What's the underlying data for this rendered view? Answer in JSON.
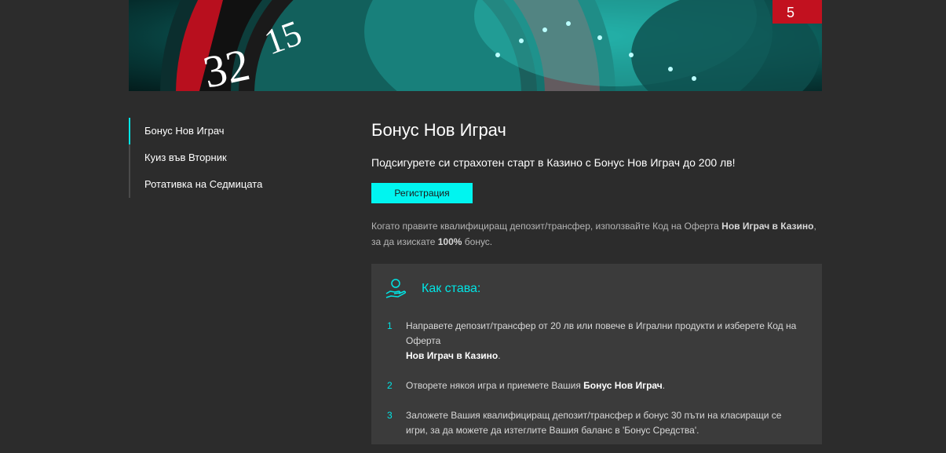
{
  "hero": {
    "wheel_numbers": [
      "32",
      "15",
      "5"
    ]
  },
  "sidebar": {
    "items": [
      {
        "label": "Бонус Нов Играч"
      },
      {
        "label": "Куиз във Вторник"
      },
      {
        "label": "Ротативка на Седмицата"
      }
    ]
  },
  "main": {
    "title": "Бонус Нов Играч",
    "subtitle": "Подсигурете си страхотен старт в Казино с Бонус Нов Играч до 200 лв!",
    "register_label": "Регистрация",
    "desc_part1": "Когато правите квалифициращ депозит/трансфер, използвайте Код на Оферта ",
    "desc_code": "Нов Играч в Казино",
    "desc_part2": ",",
    "desc_part3": "за да изискате ",
    "desc_percent": "100%",
    "desc_part4": " бонус."
  },
  "howto": {
    "title": "Как става:",
    "steps": [
      {
        "num": "1",
        "text": "Направете депозит/трансфер от 20 лв или повече в Игрални продукти и изберете Код на Оферта ",
        "bold": "Нов Играч в Казино",
        "after": "."
      },
      {
        "num": "2",
        "text": "Отворете някоя игра и приемете Вашия ",
        "bold": "Бонус Нов Играч",
        "after": "."
      },
      {
        "num": "3",
        "text": "Заложете Вашия квалифициращ депозит/трансфер и бонус 30 пъти на класиращи се игри, за да можете да изтеглите Вашия баланс в 'Бонус Средства'.",
        "bold": "",
        "after": ""
      }
    ]
  },
  "colors": {
    "accent": "#00e5e5",
    "button": "#00f5f0",
    "background": "#2c2c2c",
    "panel": "#3b3b3b"
  }
}
